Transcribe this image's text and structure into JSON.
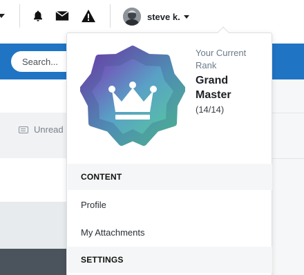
{
  "header": {
    "user": {
      "name": "steve k."
    },
    "icons": [
      "notification-bell-icon",
      "envelope-icon",
      "warning-icon"
    ]
  },
  "search": {
    "placeholder": "Search..."
  },
  "background": {
    "unread_label": "Unread"
  },
  "dropdown": {
    "rank": {
      "caption": "Your Current Rank",
      "name": "Grand Master",
      "progress": "(14/14)",
      "badge_gradient": [
        "#7b3fb8",
        "#5aa3c8",
        "#57c9a0"
      ]
    },
    "sections": [
      {
        "title": "CONTENT",
        "items": [
          "Profile",
          "My Attachments"
        ]
      },
      {
        "title": "SETTINGS",
        "items": []
      }
    ]
  },
  "colors": {
    "brand_blue": "#1f74c4",
    "dark_footer": "#4b535c"
  }
}
